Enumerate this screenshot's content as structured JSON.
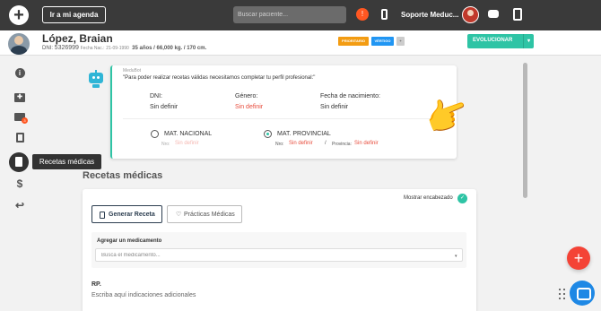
{
  "topbar": {
    "agenda_label": "Ir a mi agenda",
    "search_placeholder": "Buscar paciente...",
    "notification_count": "!",
    "user_name": "Soporte Meduc...",
    "accent_color": "#ff5722"
  },
  "patient": {
    "name": "López, Braian",
    "dni_label": "DNI:",
    "dni": "5326999",
    "birth_label": "Fecha Nac.:",
    "birth": "21-09-1990",
    "stats": "35 años / 66,000 kg. / 170 cm.",
    "badge_1": "PRIORITARIO",
    "badge_2": "VÉRTIGO",
    "badge_3": "+",
    "evolve_label": "EVOLUCIONAR",
    "evolve_caret": "▾"
  },
  "sidebar": {
    "info_icon": "i",
    "kit_icon": "✚",
    "folder_badge": "3",
    "dollar_icon": "$",
    "back_icon": "↩",
    "tooltip": "Recetas médicas"
  },
  "warning": {
    "sender": "MeduBot",
    "message": "\"Para poder realizar recetas válidas necesitamos completar tu perfil profesional:\"",
    "dni_label": "DNI:",
    "dni_value": "Sin definir",
    "gender_label": "Género:",
    "gender_value": "Sin definir",
    "birth_label": "Fecha de nacimiento:",
    "birth_value": "Sin definir",
    "nacional_label": "MAT. NACIONAL",
    "nacional_nro_label": "Nro:",
    "nacional_nro_value": "Sin definir",
    "provincial_label": "MAT. PROVINCIAL",
    "provincial_nro_label": "Nro:",
    "provincial_nro_value": "Sin definir",
    "slash": "/",
    "provincia_label": "Provincia:",
    "provincia_value": "Sin definir",
    "hand_emoji": "👉"
  },
  "main": {
    "section_title": "Recetas médicas",
    "show_header_label": "Mostrar encabezado",
    "show_header_icon": "✓",
    "generate_label": "Generar Receta",
    "practices_label": "Prácticas Médicas",
    "practices_icon": "♡",
    "add_med_label": "Agregar un medicamento",
    "med_search_placeholder": "Busca el medicamento...",
    "med_caret": "▾",
    "rp_label": "RP.",
    "rp_placeholder": "Escriba aquí indicaciones adicionales"
  },
  "fab": {
    "add_icon": "+"
  }
}
